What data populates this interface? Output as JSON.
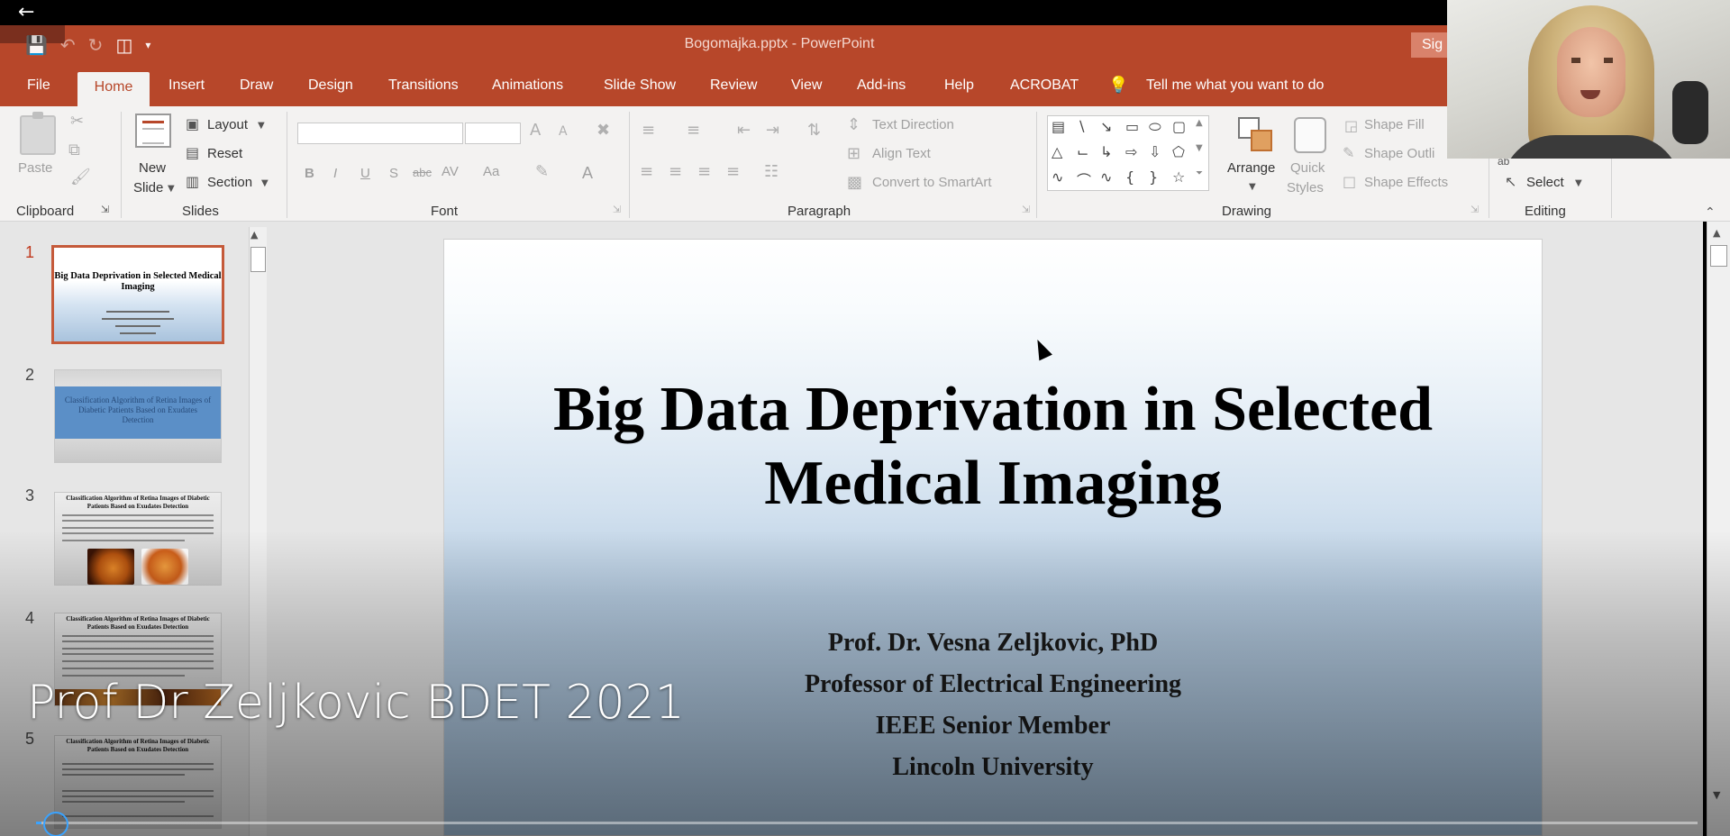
{
  "video": {
    "caption": "Prof Dr Zeljkovic BDET 2021",
    "progress": 0.003
  },
  "app": {
    "doc_title": "Bogomajka.pptx  -  PowerPoint",
    "signin_label": "Sig",
    "tell_me": "Tell me what you want to do"
  },
  "tabs": [
    "File",
    "Home",
    "Insert",
    "Draw",
    "Design",
    "Transitions",
    "Animations",
    "Slide Show",
    "Review",
    "View",
    "Add-ins",
    "Help",
    "ACROBAT"
  ],
  "ribbon": {
    "clipboard": {
      "paste": "Paste",
      "label": "Clipboard"
    },
    "slides": {
      "new_slide_1": "New",
      "new_slide_2": "Slide",
      "layout": "Layout",
      "reset": "Reset",
      "section": "Section",
      "label": "Slides"
    },
    "font": {
      "label": "Font",
      "bold": "B",
      "italic": "I",
      "underline": "U",
      "shadow": "S",
      "strike": "abc",
      "spacing": "AV",
      "case": "Aa",
      "color": "A",
      "grow": "A",
      "shrink": "A"
    },
    "paragraph": {
      "label": "Paragraph",
      "text_direction": "Text Direction",
      "align_text": "Align Text",
      "convert_smartart": "Convert to SmartArt"
    },
    "drawing": {
      "label": "Drawing",
      "arrange": "Arrange",
      "quick_styles_1": "Quick",
      "quick_styles_2": "Styles",
      "shape_fill": "Shape Fill",
      "shape_outline": "Shape Outli",
      "shape_effects": "Shape Effects"
    },
    "editing": {
      "label": "Editing",
      "select": "Select"
    }
  },
  "slides_panel": [
    {
      "num": "1",
      "title": "Big Data Deprivation in Selected Medical Imaging"
    },
    {
      "num": "2",
      "title": "Classification Algorithm of Retina Images of Diabetic Patients Based on Exudates Detection"
    },
    {
      "num": "3",
      "title": "Classification Algorithm of Retina Images of Diabetic Patients Based on Exudates Detection"
    },
    {
      "num": "4",
      "title": "Classification Algorithm of Retina Images of Diabetic Patients Based on Exudates Detection"
    },
    {
      "num": "5",
      "title": "Classification Algorithm of Retina Images of Diabetic Patients Based on Exudates Detection"
    }
  ],
  "slide": {
    "title_line1": "Big Data Deprivation in Selected",
    "title_line2": "Medical Imaging",
    "author": "Prof. Dr. Vesna Zeljkovic, PhD",
    "position": "Professor of Electrical Engineering",
    "membership": "IEEE Senior Member",
    "affiliation": "Lincoln University"
  },
  "colors": {
    "accent": "#b7472a",
    "progress": "#3aa3ff"
  }
}
